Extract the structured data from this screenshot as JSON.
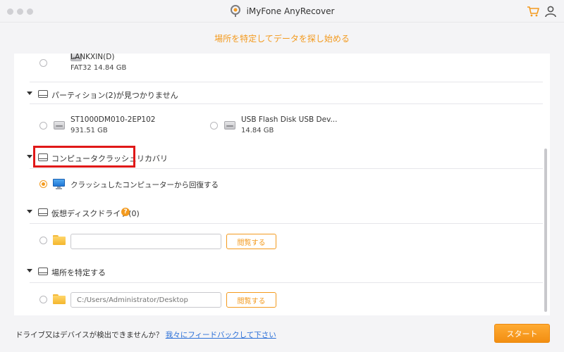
{
  "window": {
    "title": "iMyFone AnyRecover"
  },
  "header": {
    "subtitle": "場所を特定してデータを探し始める"
  },
  "drives_top": [
    {
      "name": "LANKXIN(D)",
      "size": "FAT32     14.84 GB"
    }
  ],
  "lost_partitions": {
    "label": "パーティション(2)が見つかりません",
    "items": [
      {
        "name": "ST1000DM010-2EP102",
        "size": "931.51 GB"
      },
      {
        "name": "USB Flash Disk USB Dev...",
        "size": "14.84 GB"
      }
    ]
  },
  "crash_recovery": {
    "label": "コンピュータクラッシュリカバリ",
    "option": "クラッシュしたコンピューターから回復する"
  },
  "virtual_drive": {
    "label": "仮想ディスクドライブ(0)",
    "help": "?",
    "path_value": "",
    "browse": "閲覧する"
  },
  "specify_location": {
    "label": "場所を特定する",
    "path_placeholder": "C:/Users/Administrator/Desktop",
    "browse": "閲覧する"
  },
  "footer": {
    "question": "ドライブ又はデバイスが検出できませんか？",
    "link": "我々にフィードバックして下さい",
    "start": "スタート"
  },
  "colors": {
    "accent": "#f39a1e",
    "highlight": "#e01818",
    "link": "#2a6fd8"
  }
}
